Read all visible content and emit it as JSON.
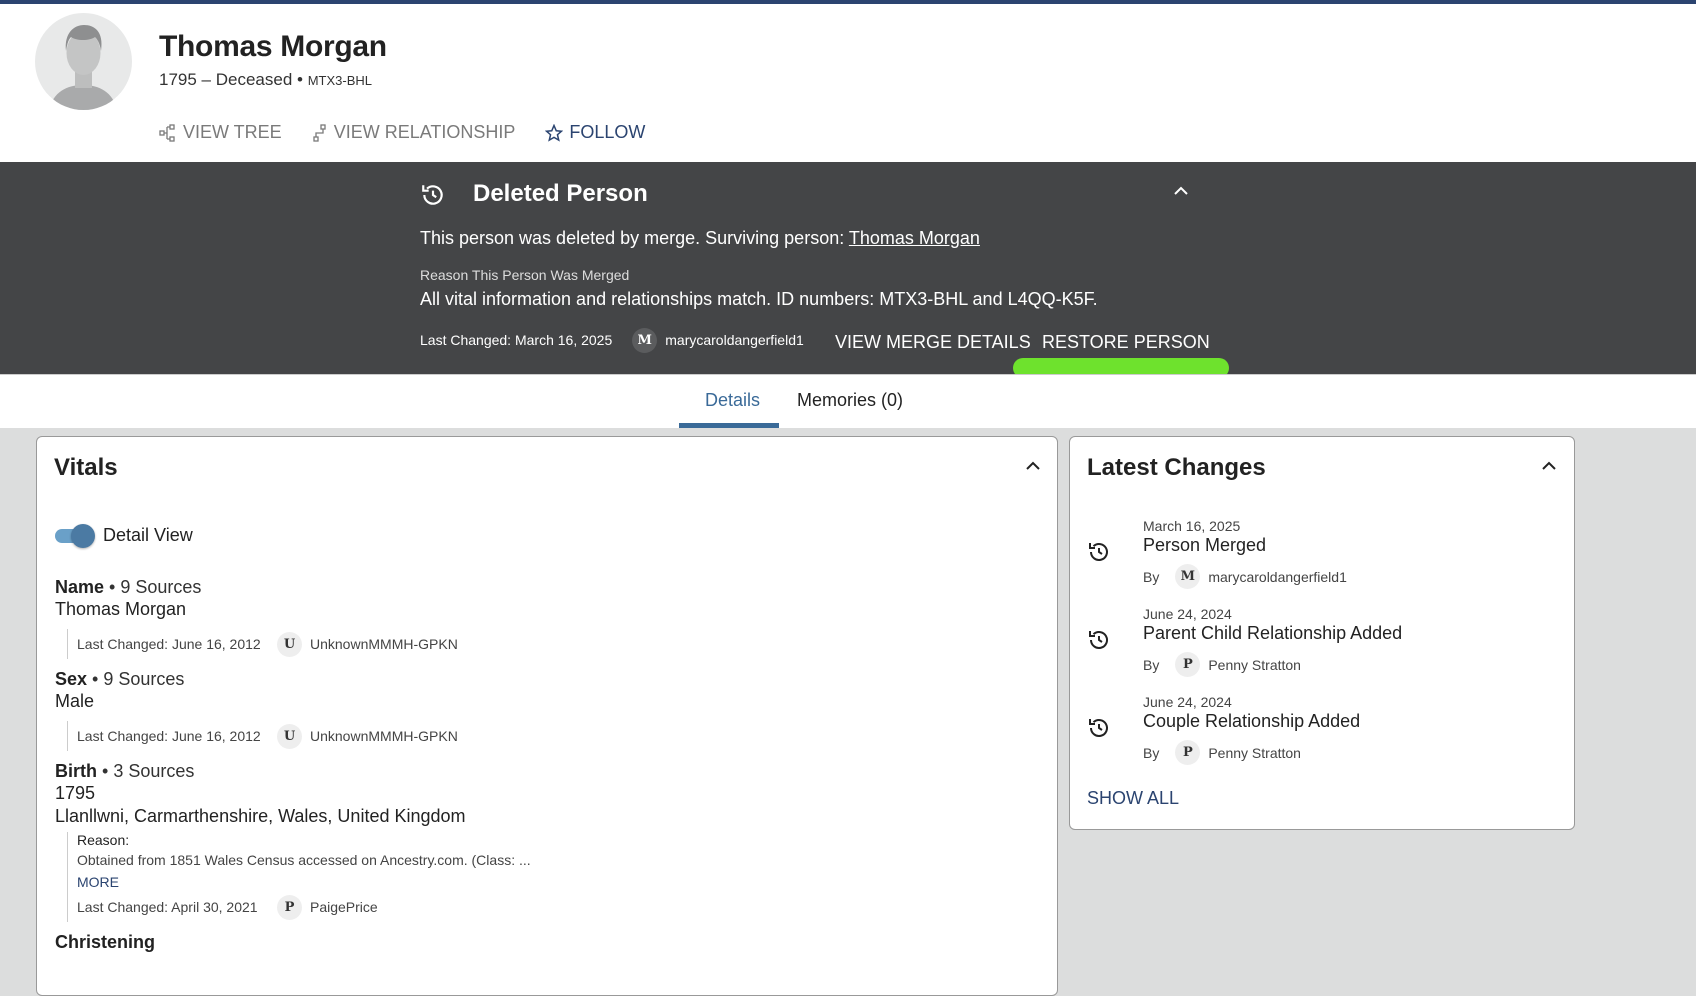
{
  "person": {
    "name": "Thomas Morgan",
    "lifespan": "1795 – Deceased",
    "separator": " • ",
    "id": "MTX3-BHL"
  },
  "actions": {
    "view_tree": "VIEW TREE",
    "view_relationship": "VIEW RELATIONSHIP",
    "follow": "FOLLOW"
  },
  "banner": {
    "title": "Deleted Person",
    "message": "This person was deleted by merge. Surviving person: ",
    "surviving_link": "Thomas Morgan",
    "reason_label": "Reason This Person Was Merged",
    "reason": "All vital information and relationships match. ID numbers: MTX3-BHL and L4QQ-K5F.",
    "last_changed": "Last Changed: March 16, 2025",
    "user_initial": "M",
    "user": "marycaroldangerfield1",
    "view_merge": "VIEW MERGE DETAILS",
    "restore": "RESTORE PERSON"
  },
  "tabs": [
    {
      "label": "Details"
    },
    {
      "label": "Memories (0)"
    }
  ],
  "vitals": {
    "title": "Vitals",
    "toggle_label": "Detail View",
    "toggle_on": true,
    "items": [
      {
        "label": "Name",
        "sources": "9 Sources",
        "values": [
          "Thomas Morgan"
        ],
        "last_changed": "Last Changed: June 16, 2012",
        "initial": "U",
        "user": "UnknownMMMH-GPKN"
      },
      {
        "label": "Sex",
        "sources": "9 Sources",
        "values": [
          "Male"
        ],
        "last_changed": "Last Changed: June 16, 2012",
        "initial": "U",
        "user": "UnknownMMMH-GPKN"
      },
      {
        "label": "Birth",
        "sources": "3 Sources",
        "values": [
          "1795",
          "Llanllwni, Carmarthenshire, Wales, United Kingdom"
        ],
        "reason_label": "Reason:",
        "reason": "Obtained from 1851 Wales Census accessed on Ancestry.com. (Class: ...",
        "more": "MORE",
        "last_changed": "Last Changed: April 30, 2021",
        "initial": "P",
        "user": "PaigePrice"
      },
      {
        "label": "Christening"
      }
    ]
  },
  "latest": {
    "title": "Latest Changes",
    "by": "By",
    "show_all": "SHOW ALL",
    "items": [
      {
        "date": "March 16, 2025",
        "title": "Person Merged",
        "initial": "M",
        "user": "marycaroldangerfield1"
      },
      {
        "date": "June 24, 2024",
        "title": "Parent Child Relationship Added",
        "initial": "P",
        "user": "Penny Stratton"
      },
      {
        "date": "June 24, 2024",
        "title": "Couple Relationship Added",
        "initial": "P",
        "user": "Penny Stratton"
      }
    ]
  },
  "colors": {
    "accent": "#2b4470",
    "banner": "#444547",
    "highlight": "#6ee22d",
    "tab": "#3a6a98"
  }
}
